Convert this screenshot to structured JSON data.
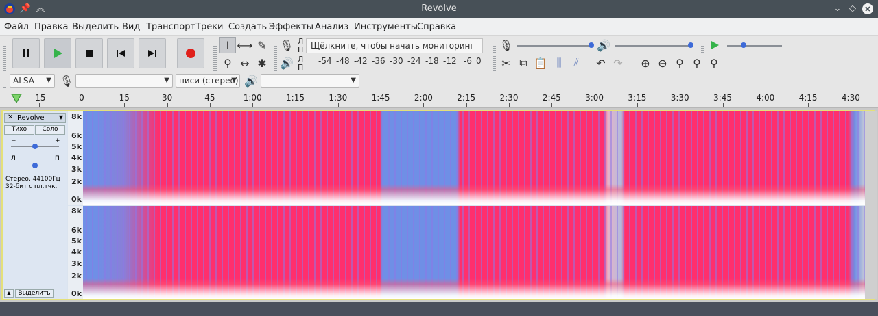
{
  "window": {
    "title": "Revolve"
  },
  "menu": [
    "Файл",
    "Правка",
    "Выделить",
    "Вид",
    "Транспорт",
    "Треки",
    "Создать",
    "Эффекты",
    "Анализ",
    "Инструменты",
    "Справка"
  ],
  "meter": {
    "rec_l": "Л",
    "rec_r": "П",
    "play_l": "Л",
    "play_r": "П",
    "monitor_text": "Щёлкните, чтобы начать мониторинг",
    "scale": [
      "-54",
      "-48",
      "-42",
      "-36",
      "-30",
      "-24",
      "-18",
      "-12",
      "-6",
      "0"
    ]
  },
  "device": {
    "host": "ALSA",
    "rec_channels": "писи (стерео)"
  },
  "ruler": [
    "-15",
    "0",
    "15",
    "30",
    "45",
    "1:00",
    "1:15",
    "1:30",
    "1:45",
    "2:00",
    "2:15",
    "2:30",
    "2:45",
    "3:00",
    "3:15",
    "3:30",
    "3:45",
    "4:00",
    "4:15",
    "4:30"
  ],
  "track": {
    "name": "Revolve",
    "mute": "Тихо",
    "solo": "Соло",
    "gain_minus": "−",
    "gain_plus": "+",
    "pan_l": "Л",
    "pan_r": "П",
    "info1": "Стерео, 44100Гц",
    "info2": "32-бит с пл.тчк.",
    "select": "Выделить"
  },
  "spectro_axis": [
    "8k",
    "6k",
    "5k",
    "4k",
    "3k",
    "2k",
    "0k"
  ],
  "colors": {
    "titlebar": "#475057",
    "spectrum_hot": "#ff2f6d",
    "spectrum_cold": "#6f8fe6",
    "track_border": "#e4e07a"
  }
}
